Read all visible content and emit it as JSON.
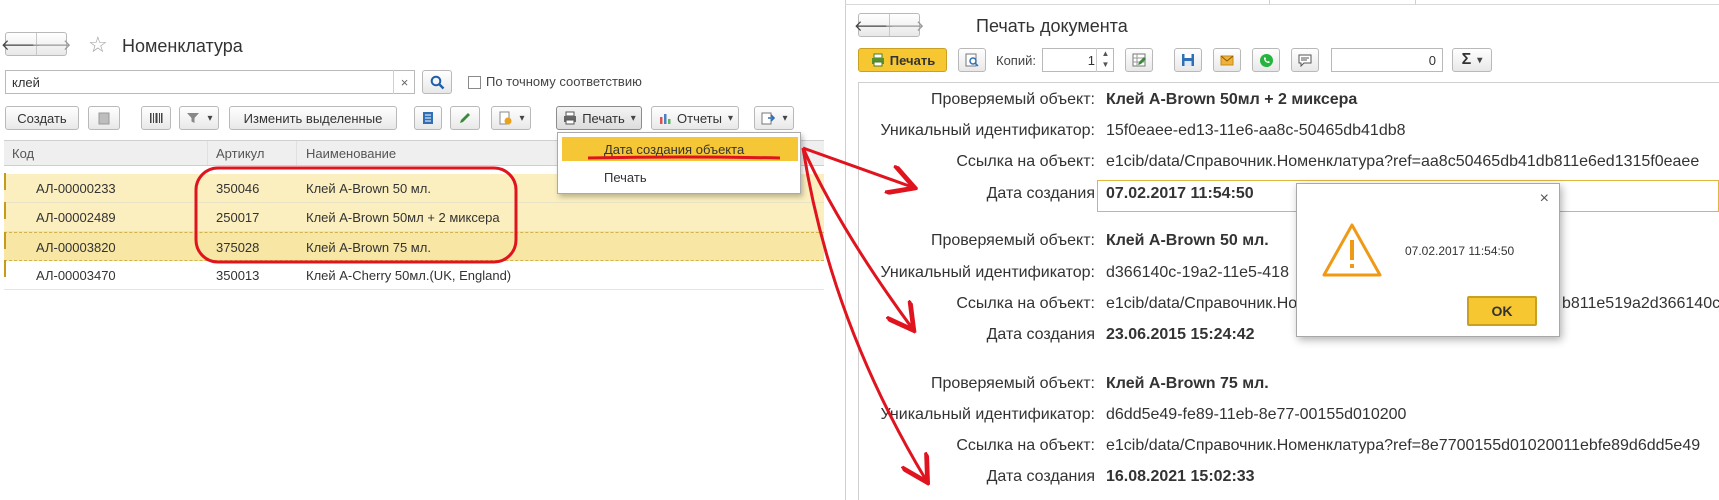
{
  "left": {
    "title": "Номенклатура",
    "search_value": "клей",
    "search_clear": "×",
    "exact_match_label": "По точному соответствию",
    "toolbar": {
      "create": "Создать",
      "change_selected": "Изменить выделенные",
      "print": "Печать",
      "reports": "Отчеты"
    },
    "columns": [
      "Код",
      "Артикул",
      "Наименование"
    ],
    "rows": [
      {
        "code": "АЛ-00000233",
        "article": "350046",
        "name": "Клей A-Brown 50 мл."
      },
      {
        "code": "АЛ-00002489",
        "article": "250017",
        "name": "Клей A-Brown 50мл + 2 миксера"
      },
      {
        "code": "АЛ-00003820",
        "article": "375028",
        "name": "Клей A-Brown 75 мл."
      },
      {
        "code": "АЛ-00003470",
        "article": "350013",
        "name": "Клей A-Cherry 50мл.(UK, England)"
      }
    ],
    "print_menu": [
      "Дата создания объекта",
      "Печать"
    ]
  },
  "right": {
    "title": "Печать документа",
    "toolbar": {
      "print": "Печать",
      "copies_label": "Копий:",
      "copies_value": "1",
      "sum_value": "0",
      "sigma": "Σ"
    },
    "labels": {
      "object": "Проверяемый объект:",
      "uid": "Уникальный идентификатор:",
      "link": "Ссылка на объект:",
      "created": "Дата создания"
    },
    "records": [
      {
        "object": "Клей A-Brown 50мл + 2 миксера",
        "uid": "15f0eaee-ed13-11e6-aa8c-50465db41db8",
        "link": "e1cib/data/Справочник.Номенклатура?ref=aa8c50465db41db811e6ed1315f0eaee",
        "created": "07.02.2017 11:54:50"
      },
      {
        "object": "Клей A-Brown 50 мл.",
        "uid": "d366140c-19a2-11e5-418",
        "link": "e1cib/data/Справочник.Но",
        "link_tail": "b811e519a2d366140c",
        "created": "23.06.2015 15:24:42"
      },
      {
        "object": "Клей A-Brown 75 мл.",
        "uid": "d6dd5e49-fe89-11eb-8e77-00155d010200",
        "link": "e1cib/data/Справочник.Номенклатура?ref=8e7700155d01020011ebfe89d6dd5e49",
        "created": "16.08.2021 15:02:33"
      }
    ]
  },
  "message_box": {
    "text": "07.02.2017 11:54:50",
    "ok": "OK",
    "close": "×"
  },
  "colors": {
    "selection": "#fbefbf",
    "accent_yellow": "#f5c635",
    "annotation_red": "#e0141e"
  }
}
